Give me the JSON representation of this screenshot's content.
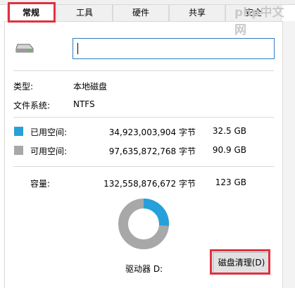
{
  "tabs": [
    {
      "label": "常规",
      "active": true
    },
    {
      "label": "工具",
      "active": false
    },
    {
      "label": "硬件",
      "active": false
    },
    {
      "label": "共享",
      "active": false
    },
    {
      "label": "安全",
      "active": false
    }
  ],
  "watermark": "php中文网",
  "volume_name_value": "",
  "info": {
    "type_label": "类型:",
    "type_value": "本地磁盘",
    "fs_label": "文件系统:",
    "fs_value": "NTFS"
  },
  "used": {
    "label": "已用空间:",
    "bytes": "34,923,003,904 字节",
    "size": "32.5 GB",
    "color": "#26a0da"
  },
  "free": {
    "label": "可用空间:",
    "bytes": "97,635,872,768 字节",
    "size": "90.9 GB",
    "color": "#a8a8a8"
  },
  "capacity": {
    "label": "容量:",
    "bytes": "132,558,876,672 字节",
    "size": "123 GB"
  },
  "usage": {
    "used_fraction": 0.263
  },
  "drive_label": "驱动器 D:",
  "cleanup_button": "磁盘清理(D)",
  "highlight_color": "#e03040"
}
